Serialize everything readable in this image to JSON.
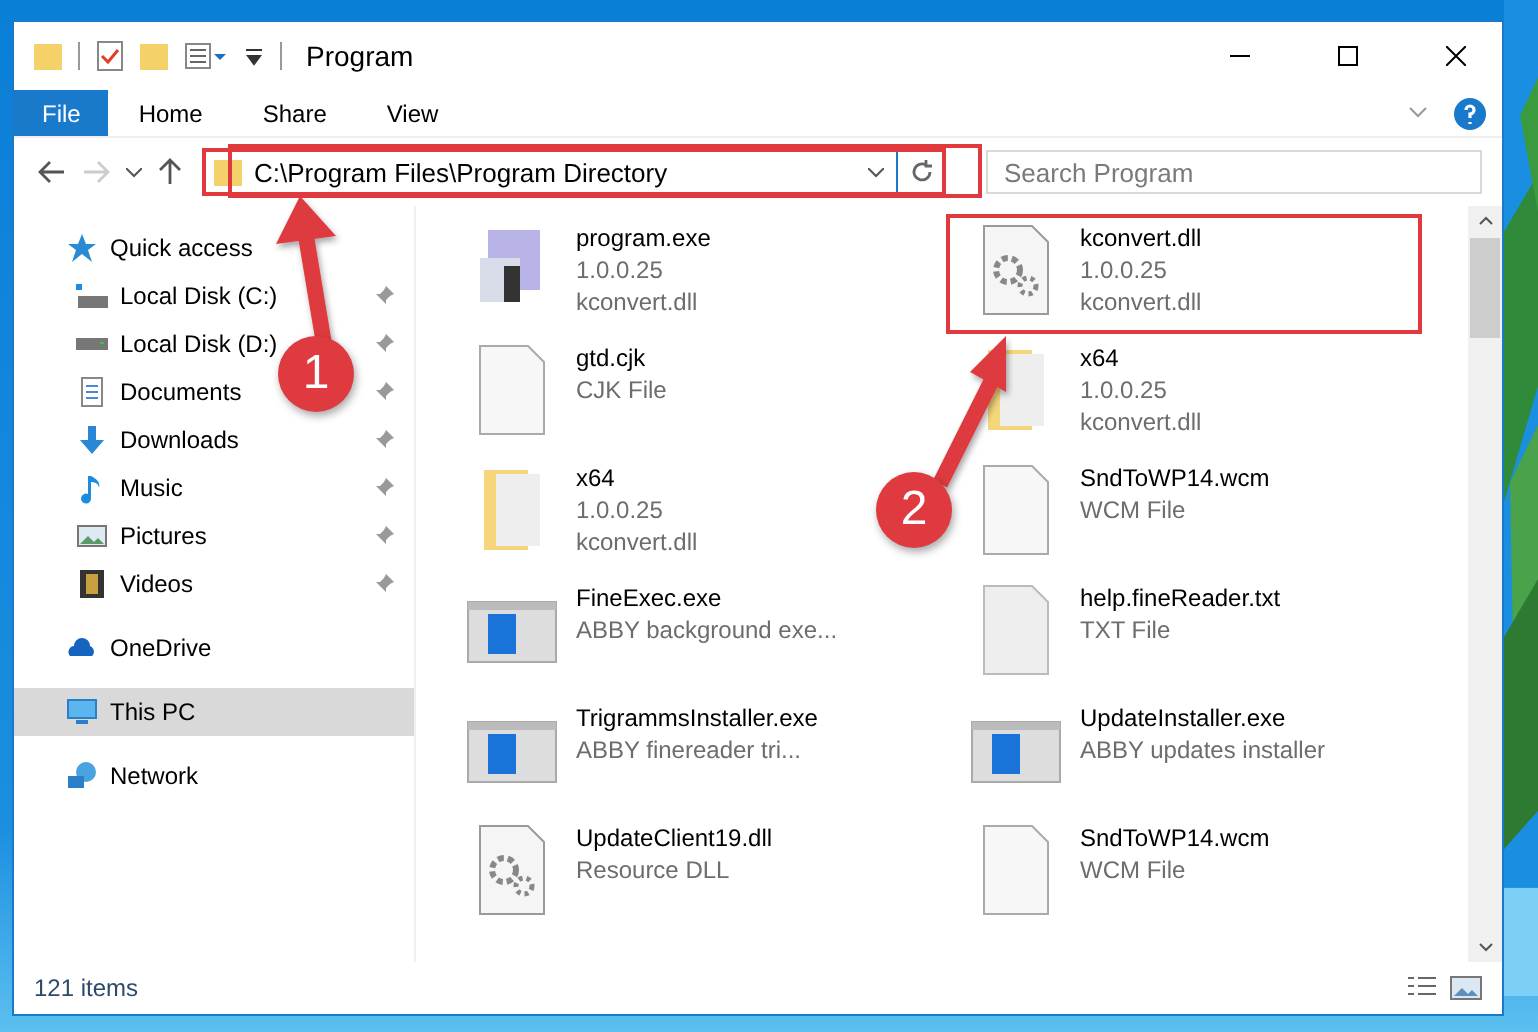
{
  "window": {
    "title": "Program"
  },
  "ribbon_tabs": [
    {
      "label": "File",
      "kind": "file-menu"
    },
    {
      "label": "Home",
      "kind": "tab"
    },
    {
      "label": "Share",
      "kind": "tab"
    },
    {
      "label": "View",
      "kind": "tab"
    }
  ],
  "address": {
    "path": "C:\\Program Files\\Program Directory"
  },
  "search": {
    "placeholder": "Search Program"
  },
  "sidebar": {
    "items": [
      {
        "label": "Quick access",
        "kind": "star",
        "selected": false,
        "children": [
          {
            "label": "Local Disk (C:)",
            "kind": "system-drive",
            "pinned": true
          },
          {
            "label": "Local Disk (D:)",
            "kind": "drive",
            "pinned": true
          },
          {
            "label": "Documents",
            "kind": "documents",
            "pinned": true
          },
          {
            "label": "Downloads",
            "kind": "downloads",
            "pinned": true
          },
          {
            "label": "Music",
            "kind": "music",
            "pinned": true
          },
          {
            "label": "Pictures",
            "kind": "pictures",
            "pinned": true
          },
          {
            "label": "Videos",
            "kind": "videos",
            "pinned": true
          }
        ]
      },
      {
        "label": "OneDrive",
        "kind": "cloud",
        "selected": false
      },
      {
        "label": "This PC",
        "kind": "computer",
        "selected": true
      },
      {
        "label": "Network",
        "kind": "network",
        "selected": false
      }
    ]
  },
  "files": [
    {
      "name": "program.exe",
      "details": [
        "1.0.0.25",
        "kconvert.dll"
      ],
      "kind": "installer"
    },
    {
      "name": "kconvert.dll",
      "details": [
        "1.0.0.25",
        "kconvert.dll"
      ],
      "kind": "gear-file"
    },
    {
      "name": "gtd.cjk",
      "details": [
        "CJK File"
      ],
      "kind": "blank-file"
    },
    {
      "name": "x64",
      "details": [
        "1.0.0.25",
        "kconvert.dll"
      ],
      "kind": "folder"
    },
    {
      "name": "x64",
      "details": [
        "1.0.0.25",
        "kconvert.dll"
      ],
      "kind": "folder"
    },
    {
      "name": "SndToWP14.wcm",
      "details": [
        "WCM File"
      ],
      "kind": "blank-file"
    },
    {
      "name": "FineExec.exe",
      "details": [
        "ABBY background exe..."
      ],
      "kind": "app-window"
    },
    {
      "name": "help.fineReader.txt",
      "details": [
        "TXT File"
      ],
      "kind": "text-file"
    },
    {
      "name": "TrigrammsInstaller.exe",
      "details": [
        "ABBY finereader tri..."
      ],
      "kind": "app-window"
    },
    {
      "name": "UpdateInstaller.exe",
      "details": [
        "ABBY updates installer"
      ],
      "kind": "app-window"
    },
    {
      "name": "UpdateClient19.dll",
      "details": [
        "Resource DLL"
      ],
      "kind": "gear-file"
    },
    {
      "name": "SndToWP14.wcm",
      "details": [
        "WCM File"
      ],
      "kind": "blank-file"
    }
  ],
  "status_bar": {
    "count": "121 items"
  },
  "annotations": [
    {
      "number": "1"
    },
    {
      "number": "2"
    }
  ]
}
